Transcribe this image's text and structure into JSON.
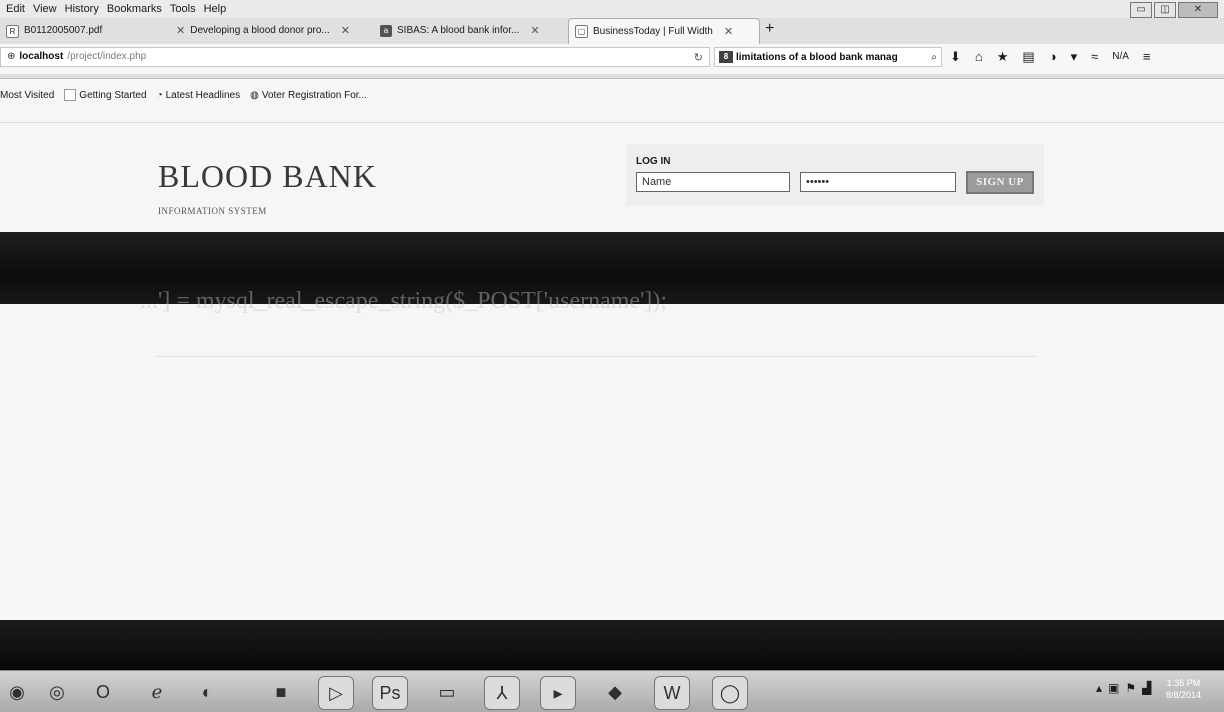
{
  "browser": {
    "menu": [
      "Edit",
      "View",
      "History",
      "Bookmarks",
      "Tools",
      "Help"
    ],
    "window_controls": [
      "▭",
      "◫",
      "✕"
    ],
    "tabs": [
      {
        "title": "B0112005007.pdf",
        "icon": "pdf-icon",
        "glyph": "R"
      },
      {
        "title": "Developing a blood donor pro...",
        "icon": "page-icon",
        "glyph": ""
      },
      {
        "title": "SIBAS: A blood bank infor...",
        "icon": "academia-icon",
        "glyph": "a"
      },
      {
        "title": "BusinessToday | Full Width",
        "icon": "page-icon",
        "glyph": "▢",
        "active": true
      }
    ],
    "new_tab": "+",
    "url_host": "localhost",
    "url_path": "/project/index.php",
    "search_text": "limitations of a blood bank manag",
    "toolbar_na": "N/A",
    "bookmarks": [
      "Most Visited",
      "Getting Started",
      "Latest Headlines",
      "Voter Registration For..."
    ]
  },
  "site": {
    "title": "BLOOD BANK",
    "subtitle": "INFORMATION SYSTEM",
    "ghost_text": "...'] = mysql_real_escape_string($_POST['username']);"
  },
  "login": {
    "label": "LOG IN",
    "name_value": "Name",
    "password_value": "••••••",
    "signup_label": "SIGN UP"
  },
  "taskbar": {
    "clock_time": "1:36 PM",
    "clock_date": "8/8/2014"
  }
}
